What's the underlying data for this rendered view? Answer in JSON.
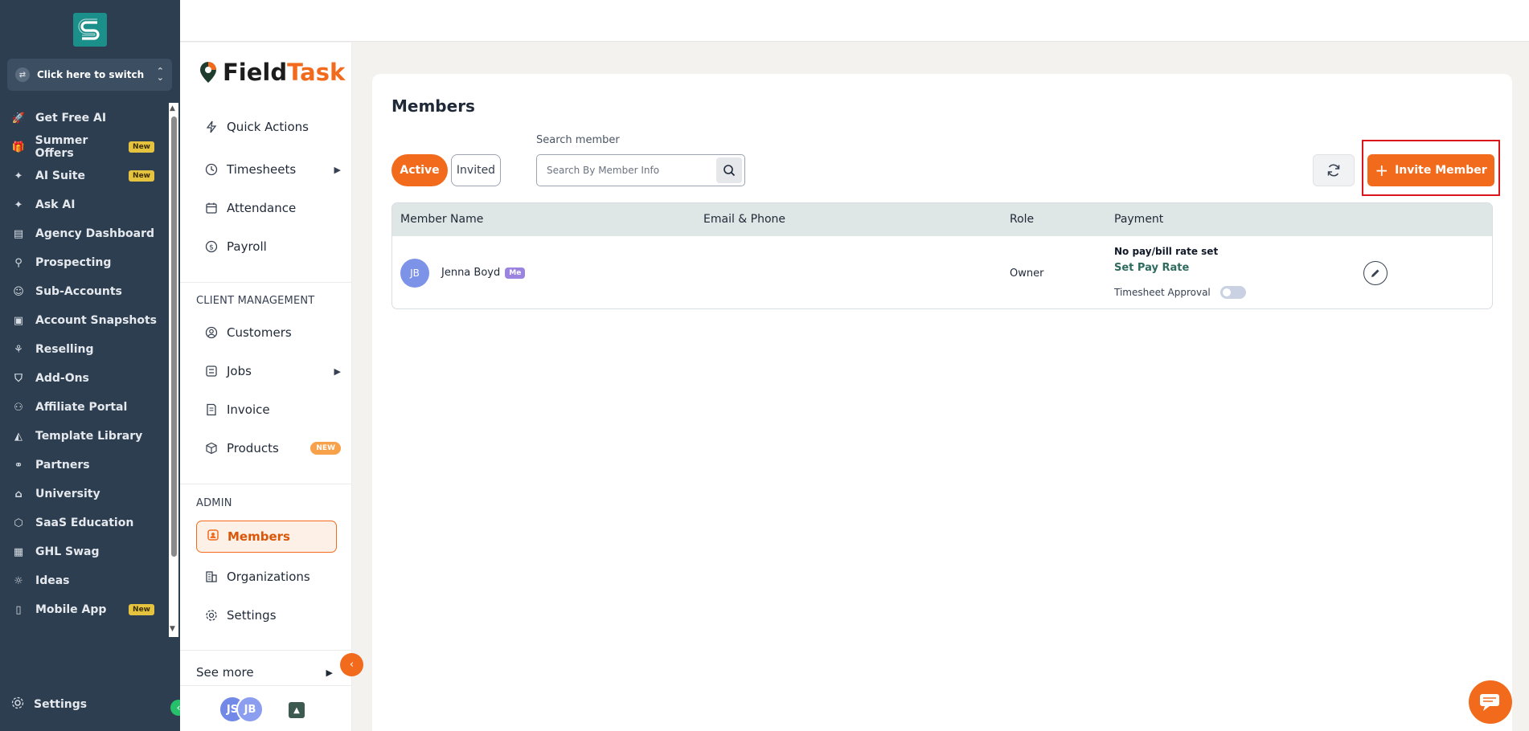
{
  "sidebar": {
    "switcher_label": "Click here to switch",
    "items": [
      {
        "label": "Get Free AI",
        "icon": "rocket-icon",
        "badge": ""
      },
      {
        "label": "Summer Offers",
        "icon": "gift-icon",
        "badge": "New"
      },
      {
        "label": "AI Suite",
        "icon": "sparkle-icon",
        "badge": "New"
      },
      {
        "label": "Ask AI",
        "icon": "sparkle-icon",
        "badge": ""
      },
      {
        "label": "Agency Dashboard",
        "icon": "dashboard-icon",
        "badge": ""
      },
      {
        "label": "Prospecting",
        "icon": "user-search-icon",
        "badge": ""
      },
      {
        "label": "Sub-Accounts",
        "icon": "user-icon",
        "badge": ""
      },
      {
        "label": "Account Snapshots",
        "icon": "snapshot-icon",
        "badge": ""
      },
      {
        "label": "Reselling",
        "icon": "reselling-icon",
        "badge": ""
      },
      {
        "label": "Add-Ons",
        "icon": "bag-icon",
        "badge": ""
      },
      {
        "label": "Affiliate Portal",
        "icon": "users-icon",
        "badge": ""
      },
      {
        "label": "Template Library",
        "icon": "shapes-icon",
        "badge": ""
      },
      {
        "label": "Partners",
        "icon": "handshake-icon",
        "badge": ""
      },
      {
        "label": "University",
        "icon": "graduation-cap-icon",
        "badge": ""
      },
      {
        "label": "SaaS Education",
        "icon": "cube-icon",
        "badge": ""
      },
      {
        "label": "GHL Swag",
        "icon": "store-icon",
        "badge": ""
      },
      {
        "label": "Ideas",
        "icon": "lightbulb-icon",
        "badge": ""
      },
      {
        "label": "Mobile App",
        "icon": "mobile-icon",
        "badge": "New"
      }
    ],
    "settings_label": "Settings"
  },
  "app": {
    "logo_field": "Field",
    "logo_task": "Task"
  },
  "subnav": {
    "quick_actions": "Quick Actions",
    "timesheets": "Timesheets",
    "attendance": "Attendance",
    "payroll": "Payroll",
    "client_section": "CLIENT MANAGEMENT",
    "customers": "Customers",
    "jobs": "Jobs",
    "invoice": "Invoice",
    "products": "Products",
    "products_badge": "NEW",
    "admin_section": "ADMIN",
    "members": "Members",
    "organizations": "Organizations",
    "settings": "Settings",
    "see_more": "See more",
    "avatar1": "JS",
    "avatar2": "JB"
  },
  "main": {
    "title": "Members",
    "tab_active": "Active",
    "tab_invited": "Invited",
    "search_label": "Search member",
    "search_placeholder": "Search By Member Info",
    "invite_label": "Invite Member",
    "columns": {
      "name": "Member Name",
      "email": "Email & Phone",
      "role": "Role",
      "payment": "Payment"
    },
    "rows": [
      {
        "initials": "JB",
        "name": "Jenna Boyd",
        "me_badge": "Me",
        "role": "Owner",
        "pay_status": "No pay/bill rate set",
        "pay_link": "Set Pay Rate",
        "timesheet_label": "Timesheet Approval",
        "timesheet_approval": false
      }
    ]
  },
  "colors": {
    "brand_orange": "#f26b1d",
    "sidebar_bg": "#2d3e50",
    "highlight_red": "#d9161c"
  }
}
